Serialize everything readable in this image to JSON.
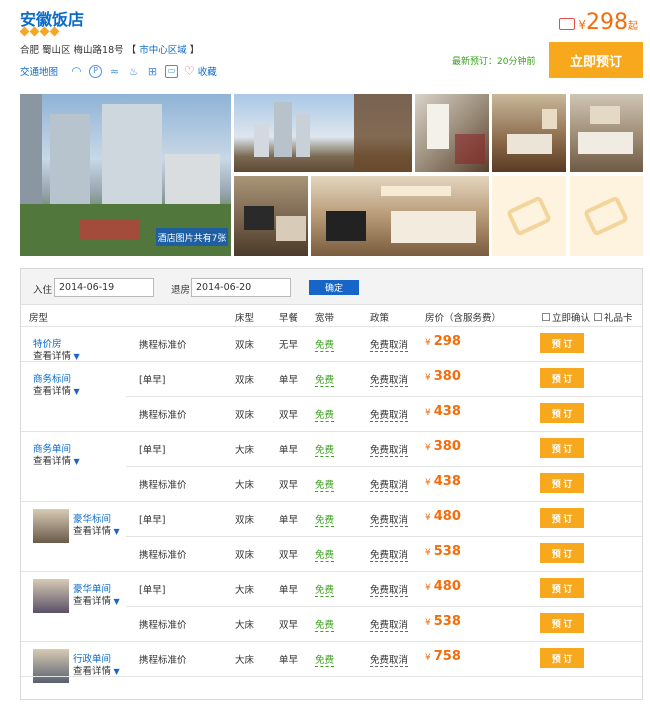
{
  "hotel": {
    "name": "安徽饭店",
    "address": "合肥 蜀山区 梅山路18号",
    "area_open": "【",
    "area": "市中心区域",
    "area_close": "】"
  },
  "toolbar": {
    "map_label": "交通地图",
    "icons": [
      "wifi-icon",
      "parking-icon",
      "pool-icon",
      "restaurant-icon",
      "gym-icon",
      "bus-icon"
    ],
    "fav_label": "收藏"
  },
  "price_top": {
    "currency": "¥",
    "value": "298",
    "suffix": "起"
  },
  "latest": "最新预订：20分钟前",
  "book_big": "立即预订",
  "gallery": {
    "count_label": "酒店图片共有7张"
  },
  "search": {
    "checkin_label": "入住",
    "checkin_value": "2014-06-19",
    "checkout_label": "退房",
    "checkout_value": "2014-06-20",
    "confirm": "确定"
  },
  "headers": {
    "room": "房型",
    "bed": "床型",
    "breakfast": "早餐",
    "broadband": "宽带",
    "policy": "政策",
    "price": "房价（含服务费）",
    "instant": "立即确认",
    "gift": "礼品卡"
  },
  "detail_label": "查看详情",
  "book_label": "预 订",
  "currency": "¥",
  "rooms": [
    {
      "name": "特价房",
      "rates": [
        {
          "plan": "携程标准价",
          "bed": "双床",
          "breakfast": "无早",
          "broadband": "免费",
          "policy": "免费取消",
          "price": "298"
        }
      ]
    },
    {
      "name": "商务标间",
      "rates": [
        {
          "plan": "[单早]",
          "bed": "双床",
          "breakfast": "单早",
          "broadband": "免费",
          "policy": "免费取消",
          "price": "380"
        },
        {
          "plan": "携程标准价",
          "bed": "双床",
          "breakfast": "双早",
          "broadband": "免费",
          "policy": "免费取消",
          "price": "438"
        }
      ]
    },
    {
      "name": "商务单间",
      "rates": [
        {
          "plan": "[单早]",
          "bed": "大床",
          "breakfast": "单早",
          "broadband": "免费",
          "policy": "免费取消",
          "price": "380"
        },
        {
          "plan": "携程标准价",
          "bed": "大床",
          "breakfast": "双早",
          "broadband": "免费",
          "policy": "免费取消",
          "price": "438"
        }
      ]
    },
    {
      "name": "豪华标间",
      "rates": [
        {
          "plan": "[单早]",
          "bed": "双床",
          "breakfast": "单早",
          "broadband": "免费",
          "policy": "免费取消",
          "price": "480"
        },
        {
          "plan": "携程标准价",
          "bed": "双床",
          "breakfast": "双早",
          "broadband": "免费",
          "policy": "免费取消",
          "price": "538"
        }
      ]
    },
    {
      "name": "豪华单间",
      "rates": [
        {
          "plan": "[单早]",
          "bed": "大床",
          "breakfast": "单早",
          "broadband": "免费",
          "policy": "免费取消",
          "price": "480"
        },
        {
          "plan": "携程标准价",
          "bed": "大床",
          "breakfast": "双早",
          "broadband": "免费",
          "policy": "免费取消",
          "price": "538"
        }
      ]
    },
    {
      "name": "行政单间",
      "rates": [
        {
          "plan": "携程标准价",
          "bed": "大床",
          "breakfast": "单早",
          "broadband": "免费",
          "policy": "免费取消",
          "price": "758"
        }
      ]
    }
  ],
  "colors": {
    "link": "#0b6bc9",
    "accent": "#f7a81c",
    "price": "#f56c0b",
    "green": "#3aa21c",
    "button_blue": "#1665c7"
  }
}
